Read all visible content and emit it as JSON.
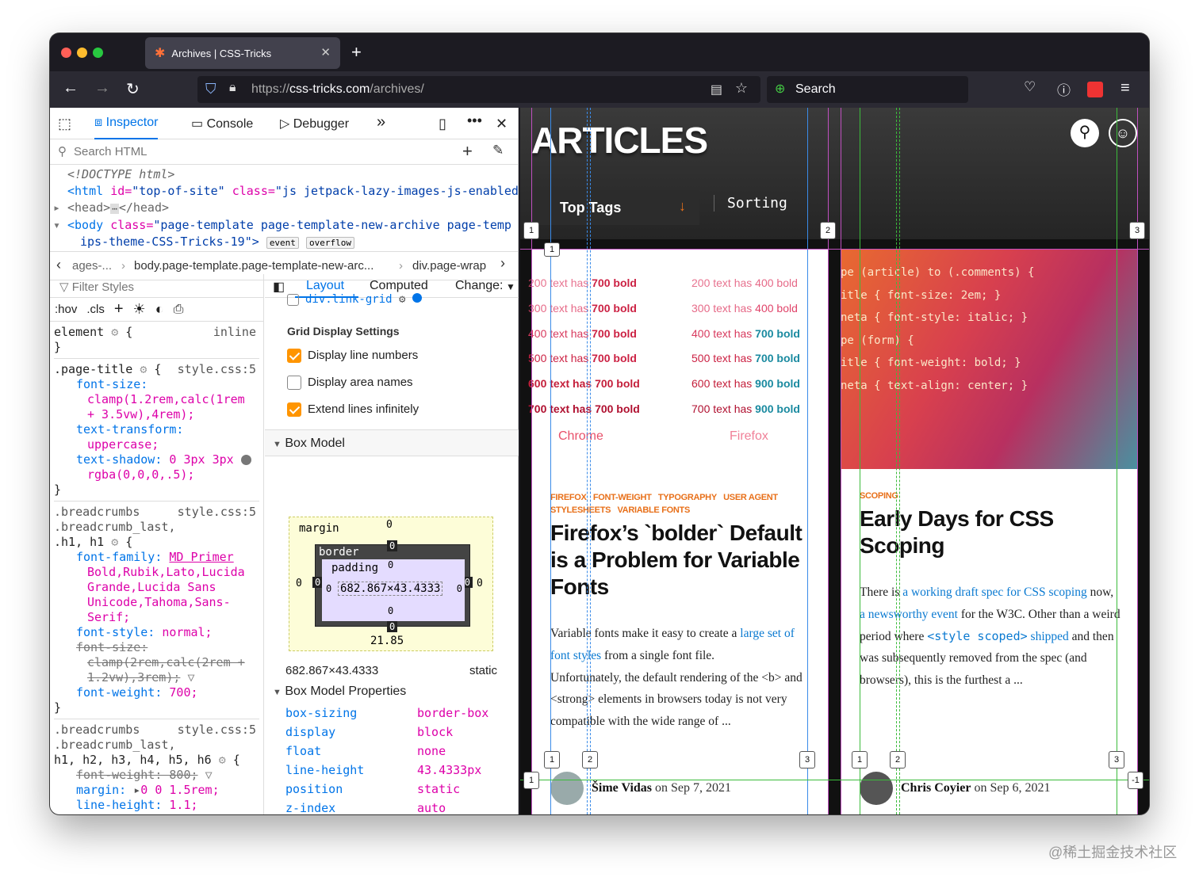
{
  "browser": {
    "tab_title": "Archives | CSS-Tricks",
    "url_scheme": "https://",
    "url_host": "css-tricks.com",
    "url_path": "/archives/",
    "search_placeholder": "Search"
  },
  "devtools": {
    "tabs": {
      "inspector": "Inspector",
      "console": "Console",
      "debugger": "Debugger"
    },
    "search_html": "Search HTML",
    "html_lines": {
      "doctype": "<!DOCTYPE html>",
      "html_open": "<html",
      "html_id_attr": "id=",
      "html_id_val": "\"top-of-site\"",
      "html_class_attr": "class=",
      "html_class_val": "\"js jetpack-lazy-images-js-enabled\"",
      "head": "<head>",
      "head_close": "</head>",
      "body_open": "<body",
      "body_class_attr": "class=",
      "body_class_val": "\"page-template page-template-new-archive page-temp",
      "body_class_cont": "ips-theme-CSS-Tricks-19\">",
      "badge_event": "event",
      "badge_overflow": "overflow"
    },
    "breadcrumbs": [
      "ages-...",
      "body.page-template.page-template-new-arc...",
      "div.page-wrap"
    ],
    "rules": {
      "filter": "Filter Styles",
      "hov": ":hov",
      "cls": ".cls",
      "element": "element",
      "element_src": "inline",
      "page_title_selector": ".page-title",
      "page_title_src": "style.css:5",
      "font_size_prop": "font-size:",
      "font_size_val1": "clamp(1.2rem,calc(1rem",
      "font_size_val2": "+ 3.5vw),4rem);",
      "text_transform_prop": "text-transform:",
      "text_transform_val": "uppercase;",
      "text_shadow_prop": "text-shadow:",
      "text_shadow_val1": "0 3px 3px",
      "text_shadow_val2": "rgba(0,0,0,.5);",
      "bc_selector1": ".breadcrumbs",
      "bc_selector2": ".breadcrumb_last,",
      "bc_selector3": ".h1, h1",
      "bc_src": "style.css:5",
      "font_family_prop": "font-family:",
      "font_family_val1": "MD Primer",
      "font_family_val2": "Bold,Rubik,Lato,Lucida",
      "font_family_val3": "Grande,Lucida Sans",
      "font_family_val4": "Unicode,Tahoma,Sans-",
      "font_family_val5": "Serif;",
      "font_style_prop": "font-style:",
      "font_style_val": "normal;",
      "font_size_struck1": "font-size:",
      "font_size_struck2": "clamp(2rem,calc(2rem +",
      "font_size_struck3": "1.2vw),3rem);",
      "font_weight_prop": "font-weight:",
      "font_weight_val": "700;",
      "bc2_selector1": ".breadcrumbs",
      "bc2_selector2": ".breadcrumb_last,",
      "bc2_selector3": "h1, h2, h3, h4, h5, h6",
      "bc2_src": "style.css:5",
      "fw_struck": "font-weight: 800;",
      "margin_prop": "margin:",
      "margin_val": "0 0 1.5rem;",
      "lh_prop": "line-height:",
      "lh_val": "1.1;"
    },
    "layout": {
      "tabs": [
        "Layout",
        "Computed",
        "Change:"
      ],
      "grid_item": "div.link-grid",
      "grid_settings": "Grid Display Settings",
      "opt_line_numbers": "Display line numbers",
      "opt_area_names": "Display area names",
      "opt_extend": "Extend lines infinitely",
      "box_model": "Box Model",
      "bm_margin": "margin",
      "bm_border": "border",
      "bm_padding": "padding",
      "bm_content": "682.867×43.4333",
      "bm_zero": "0",
      "bm_bottom": "21.85",
      "size_line": "682.867×43.4333",
      "position_line": "static",
      "bm_props_title": "Box Model Properties",
      "props": [
        {
          "k": "box-sizing",
          "v": "border-box"
        },
        {
          "k": "display",
          "v": "block"
        },
        {
          "k": "float",
          "v": "none"
        },
        {
          "k": "line-height",
          "v": "43.4333px"
        },
        {
          "k": "position",
          "v": "static"
        },
        {
          "k": "z-index",
          "v": "auto"
        }
      ]
    }
  },
  "page": {
    "title": "ARTICLES",
    "top_tags": "Top Tags",
    "sorting": "Sorting",
    "weights_left": [
      {
        "a": "200 text has ",
        "b": "700 bold"
      },
      {
        "a": "300 text has ",
        "b": "700 bold"
      },
      {
        "a": "400 text has ",
        "b": "700 bold"
      },
      {
        "a": "500 text has ",
        "b": "700 bold"
      },
      {
        "a": "600 text has ",
        "b": "700 bold"
      },
      {
        "a": "700 text has ",
        "b": "700 bold"
      }
    ],
    "weights_right": [
      {
        "a": "200 text has ",
        "b": "400 bold"
      },
      {
        "a": "300 text has ",
        "b": "400 bold"
      },
      {
        "a": "400 text has ",
        "b": "700 bold"
      },
      {
        "a": "500 text has ",
        "b": "700 bold"
      },
      {
        "a": "600 text has ",
        "b": "900 bold"
      },
      {
        "a": "700 text has ",
        "b": "900 bold"
      }
    ],
    "chrome_label": "Chrome",
    "firefox_label": "Firefox",
    "card1": {
      "tags_line1": [
        "FIREFOX",
        "FONT-WEIGHT",
        "TYPOGRAPHY",
        "USER AGENT"
      ],
      "tags_line2": [
        "STYLESHEETS",
        "VARIABLE FONTS"
      ],
      "title": "Firefox’s `bolder` Default is a Problem for Variable Fonts",
      "p1a": "Variable fonts make it easy to create a ",
      "p1link": "large set of font styles",
      "p1b": " from a single font file.",
      "p2": "Unfortunately, the default rendering of the <b> and <strong> elements in browsers today is not very compatible with the wide range of ...",
      "author": "Šime Vidas",
      "date": " on Sep 7, 2021"
    },
    "card2": {
      "code_lines": [
        "pe (article) to (.comments) {",
        "itle { font-size: 2em; }",
        "neta { font-style: italic; }",
        "",
        "pe (form) {",
        "itle { font-weight: bold; }",
        "neta { text-align: center; }"
      ],
      "tag": "SCOPING",
      "title": "Early Days for CSS Scoping",
      "p_a": "There is ",
      "p_link1": "a working draft spec for CSS scoping",
      "p_b": " now, ",
      "p_link2": "a newsworthy event",
      "p_c": " for the W3C. Other than a weird period where ",
      "p_code": "<style scoped>",
      "p_link3": "shipped",
      "p_d": " and then was subsequently removed from the spec (and browsers), this is the furthest a ...",
      "author": "Chris Coyier",
      "date": " on Sep 6, 2021"
    },
    "grid_markers": [
      "1",
      "2",
      "3",
      "1",
      "1",
      "2",
      "3",
      "1",
      "1",
      "2",
      "3",
      "-1"
    ]
  },
  "watermark": "@稀土掘金技术社区",
  "colors": {
    "accent": "#0074e8",
    "orange": "#e8701a",
    "tag_pink": "#dd00a9"
  }
}
